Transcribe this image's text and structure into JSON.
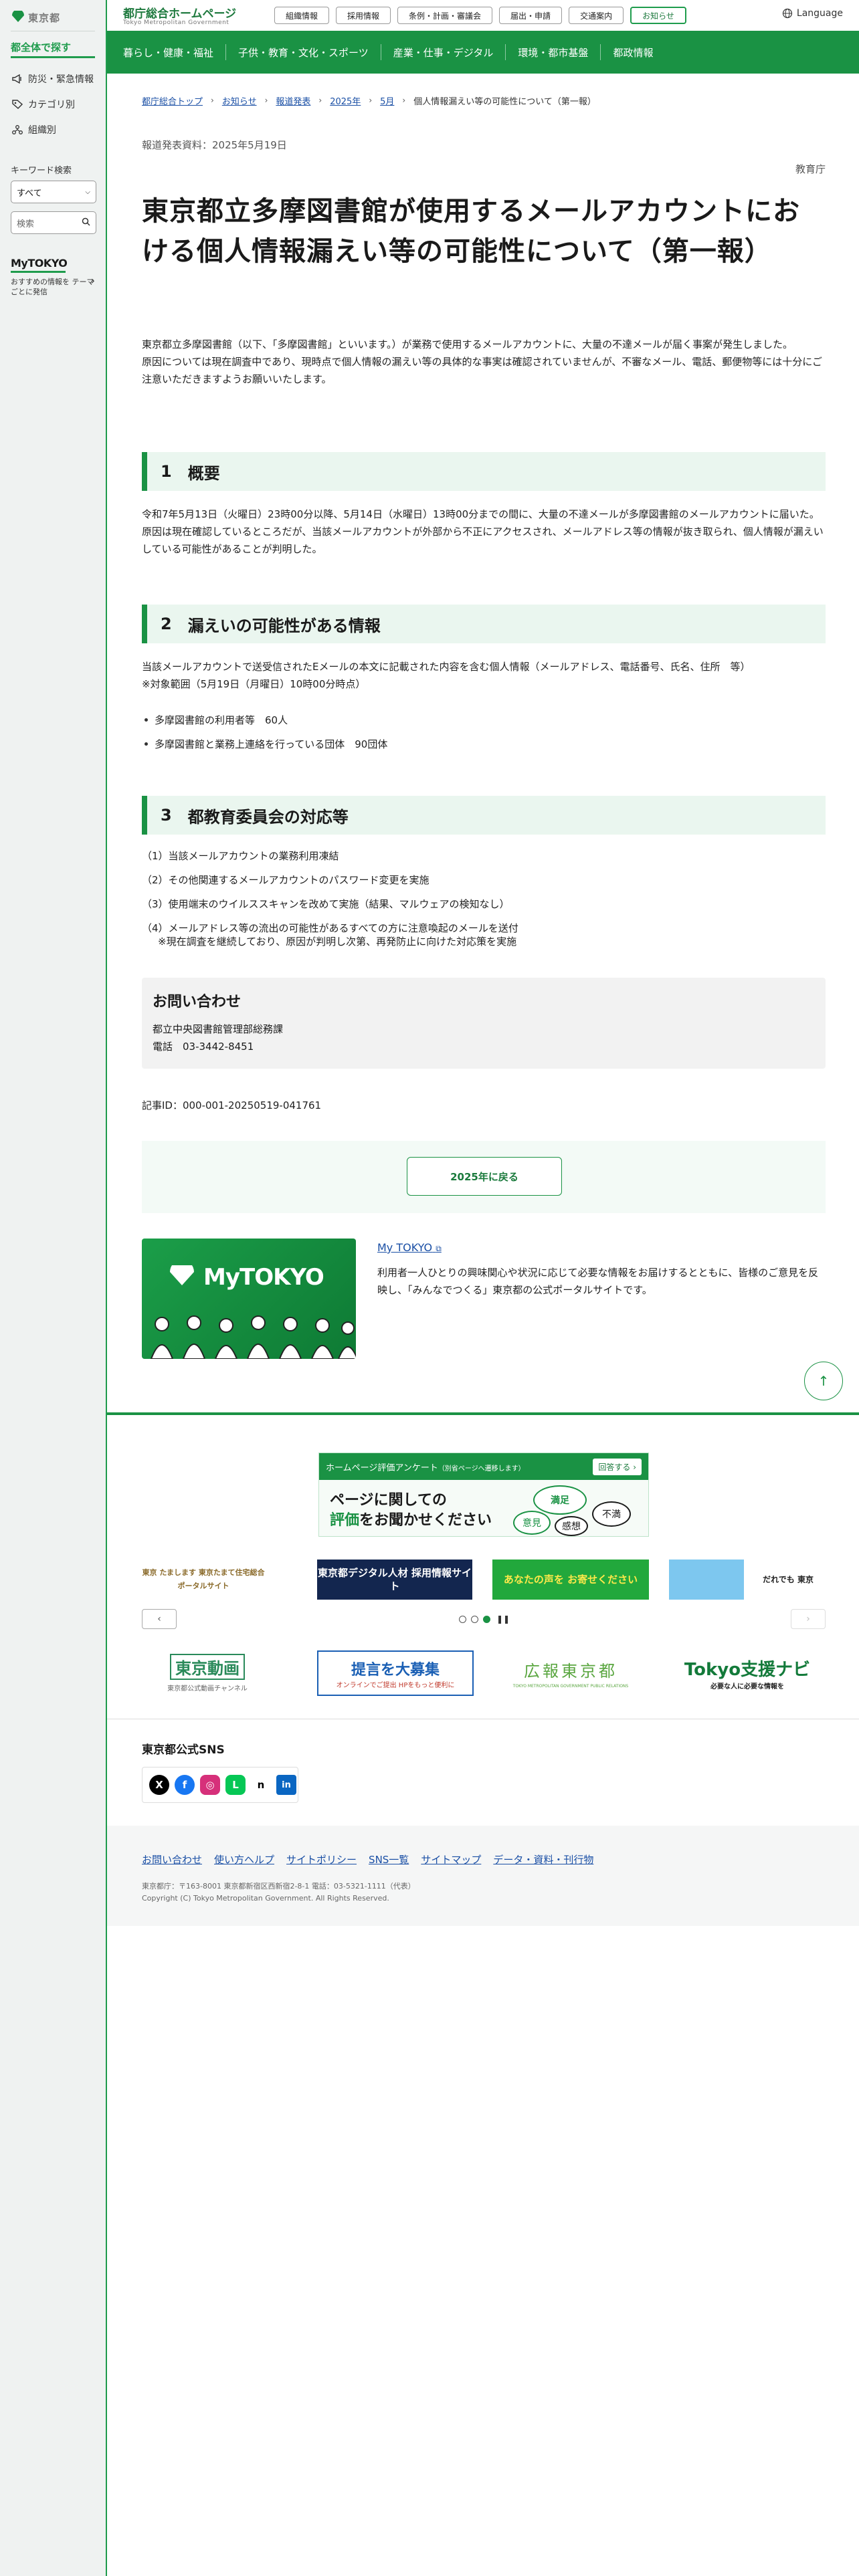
{
  "sidebar": {
    "logo_text": "東京都",
    "all_label": "都全体で探す",
    "items": [
      {
        "label": "防災・緊急情報",
        "icon": "megaphone-icon"
      },
      {
        "label": "カテゴリ別",
        "icon": "tag-icon"
      },
      {
        "label": "組織別",
        "icon": "org-icon"
      }
    ],
    "keyword_label": "キーワード検索",
    "select_value": "すべて",
    "search_placeholder": "検索",
    "mytokyo_logo": "MyTOKYO",
    "mytokyo_text": "おすすめの情報を テーマごとに発信"
  },
  "header": {
    "title": "都庁総合ホームページ",
    "subtitle": "Tokyo Metropolitan Government",
    "buttons": [
      "組織情報",
      "採用情報",
      "条例・計画・審議会",
      "届出・申請",
      "交通案内",
      "お知らせ"
    ],
    "language": "Language"
  },
  "nav": [
    "暮らし・健康・福祉",
    "子供・教育・文化・スポーツ",
    "産業・仕事・デジタル",
    "環境・都市基盤",
    "都政情報"
  ],
  "breadcrumb": [
    "都庁総合トップ",
    "お知らせ",
    "報道発表",
    "2025年",
    "5月",
    "個人情報漏えい等の可能性について（第一報）"
  ],
  "article": {
    "press_date": "報道発表資料：2025年5月19日",
    "department": "教育庁",
    "title": "東京都立多摩図書館が使用するメールアカウントにおける個人情報漏えい等の可能性について（第一報）",
    "intro": "東京都立多摩図書館（以下、「多摩図書館」といいます。）が業務で使用するメールアカウントに、大量の不達メールが届く事案が発生しました。\n原因については現在調査中であり、現時点で個人情報の漏えい等の具体的な事実は確認されていませんが、不審なメール、電話、郵便物等には十分にご注意いただきますようお願いいたします。",
    "sections": [
      {
        "num": "1",
        "heading": "概要"
      },
      {
        "num": "2",
        "heading": "漏えいの可能性がある情報"
      },
      {
        "num": "3",
        "heading": "都教育委員会の対応等"
      }
    ],
    "s1_text": "令和7年5月13日（火曜日）23時00分以降、5月14日（水曜日）13時00分までの間に、大量の不達メールが多摩図書館のメールアカウントに届いた。原因は現在確認しているところだが、当該メールアカウントが外部から不正にアクセスされ、メールアドレス等の情報が抜き取られ、個人情報が漏えいしている可能性があることが判明した。",
    "s2_text": "当該メールアカウントで送受信されたEメールの本文に記載された内容を含む個人情報（メールアドレス、電話番号、氏名、住所　等）\n※対象範囲（5月19日（月曜日）10時00分時点）",
    "s2_bullets": [
      "多摩図書館の利用者等　60人",
      "多摩図書館と業務上連絡を行っている団体　90団体"
    ],
    "s3_items": [
      "（1）当該メールアカウントの業務利用凍結",
      "（2）その他関連するメールアカウントのパスワード変更を実施",
      "（3）使用端末のウイルススキャンを改めて実施（結果、マルウェアの検知なし）",
      "（4）メールアドレス等の流出の可能性があるすべての方に注意喚起のメールを送付"
    ],
    "s3_note": "※現在調査を継続しており、原因が判明し次第、再発防止に向けた対応策を実施",
    "contact_title": "お問い合わせ",
    "contact_lines": [
      "都立中央図書館管理部総務課",
      "電話　03-3442-8451"
    ],
    "article_id": "記事ID：000-001-20250519-041761",
    "back_button": "2025年に戻る"
  },
  "mytokyo": {
    "image_logo": "MyTOKYO",
    "link": "My TOKYO",
    "desc": "利用者一人ひとりの興味関心や状況に応じて必要な情報をお届けするとともに、皆様のご意見を反映し、「みんなでつくる」東京都の公式ポータルサイトです。"
  },
  "survey": {
    "header": "ホームページ評価アンケート",
    "header_note": "（別省ページへ遷移します）",
    "answer": "回答する",
    "line1": "ページに関しての",
    "line2_em": "評価",
    "line2_rest": "をお聞かせください",
    "bubbles": [
      "満足",
      "意見",
      "不満",
      "感想"
    ]
  },
  "banners": [
    {
      "label": "東京 たまします 東京たまて住宅総合ポータルサイト"
    },
    {
      "label": "東京都デジタル人材 採用情報サイト"
    },
    {
      "label": "あなたの声を お寄せください"
    },
    {
      "label": "だれでも 東京"
    }
  ],
  "logos": [
    {
      "title": "東京動画",
      "sub": "東京都公式動画チャンネル"
    },
    {
      "title": "提言を大募集",
      "sub": "オンラインでご提出 HPをもっと便利に"
    },
    {
      "title": "広報東京都",
      "sub": "TOKYO METROPOLITAN GOVERNMENT PUBLIC RELATIONS"
    },
    {
      "title": "Tokyo支援ナビ",
      "sub": "必要な人に必要な情報を"
    }
  ],
  "sns_title": "東京都公式SNS",
  "sns": [
    {
      "icon": "x-icon",
      "glyph": "X",
      "color": "#000000"
    },
    {
      "icon": "facebook-icon",
      "glyph": "f",
      "color": "#1877f2"
    },
    {
      "icon": "instagram-icon",
      "glyph": "◎",
      "color": "#d6307a"
    },
    {
      "icon": "line-icon",
      "glyph": "L",
      "color": "#06c755"
    },
    {
      "icon": "note-icon",
      "glyph": "n",
      "color": "#ffffff"
    },
    {
      "icon": "linkedin-icon",
      "glyph": "in",
      "color": "#0a66c2"
    }
  ],
  "footer": {
    "links": [
      "お問い合わせ",
      "使い方ヘルプ",
      "サイトポリシー",
      "SNS一覧",
      "サイトマップ",
      "データ・資料・刊行物"
    ],
    "address": "東京都庁：〒163-8001 東京都新宿区西新宿2-8-1 電話：03-5321-1111（代表）",
    "copyright": "Copyright (C) Tokyo Metropolitan Government. All Rights Reserved."
  },
  "colors": {
    "brand_green": "#1a9244",
    "link_blue": "#1a4fa5",
    "section_bg": "#eaf6ef"
  }
}
